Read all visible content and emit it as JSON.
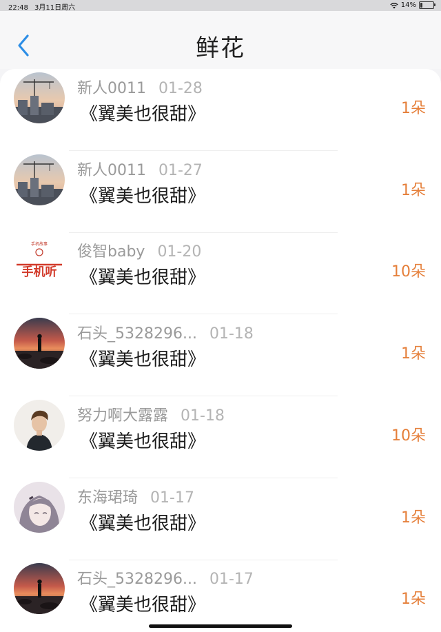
{
  "status_bar": {
    "time": "22:48",
    "date": "3月11日周六",
    "battery": "14%",
    "battery_level": 0.14,
    "icons": [
      "wifi-icon",
      "battery-icon"
    ]
  },
  "nav": {
    "title": "鲜花",
    "back_icon": "chevron-left-icon",
    "accent_color": "#2d8ee6"
  },
  "colors": {
    "count": "#e57f3a",
    "title": "#1b1b1b",
    "meta": "#9a9a9a"
  },
  "items": [
    {
      "name": "新人0011",
      "date": "01-28",
      "title": "《翼美也很甜》",
      "count": "1朵",
      "avatar": "construction-sunset-avatar"
    },
    {
      "name": "新人0011",
      "date": "01-27",
      "title": "《翼美也很甜》",
      "count": "1朵",
      "avatar": "construction-sunset-avatar"
    },
    {
      "name": "俊智baby",
      "date": "01-20",
      "title": "《翼美也很甜》",
      "count": "10朵",
      "avatar": "handwriting-logo-avatar"
    },
    {
      "name": "石头_5328296...",
      "date": "01-18",
      "title": "《翼美也很甜》",
      "count": "1朵",
      "avatar": "beach-sunset-avatar"
    },
    {
      "name": "努力啊大露露",
      "date": "01-18",
      "title": "《翼美也很甜》",
      "count": "10朵",
      "avatar": "man-portrait-avatar"
    },
    {
      "name": "东海珺琦",
      "date": "01-17",
      "title": "《翼美也很甜》",
      "count": "1朵",
      "avatar": "anime-girl-avatar"
    },
    {
      "name": "石头_5328296...",
      "date": "01-17",
      "title": "《翼美也很甜》",
      "count": "1朵",
      "avatar": "beach-sunset-avatar"
    }
  ]
}
